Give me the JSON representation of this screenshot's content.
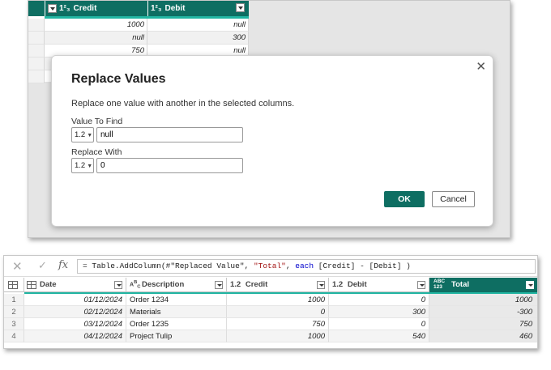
{
  "background_grid": {
    "columns": [
      {
        "type_icon": "1²₃",
        "label": "Credit"
      },
      {
        "type_icon": "1²₃",
        "label": "Debit"
      }
    ],
    "rows": [
      {
        "credit": "1000",
        "debit": "null"
      },
      {
        "credit": "null",
        "debit": "300"
      },
      {
        "credit": "750",
        "debit": "null"
      },
      {
        "credit": "",
        "debit": ""
      },
      {
        "credit": "",
        "debit": ""
      }
    ]
  },
  "dialog": {
    "title": "Replace Values",
    "description": "Replace one value with another in the selected columns.",
    "value_to_find_label": "Value To Find",
    "value_to_find_type": "1.2",
    "value_to_find": "null",
    "replace_with_label": "Replace With",
    "replace_with_type": "1.2",
    "replace_with": "0",
    "ok_label": "OK",
    "cancel_label": "Cancel",
    "close_glyph": "✕"
  },
  "formula_bar": {
    "cancel_glyph": "✕",
    "commit_glyph": "✓",
    "fx_label": "fx",
    "formula_prefix": "= Table.AddColumn(#\"Replaced Value\", ",
    "formula_string": "\"Total\"",
    "formula_mid": ", ",
    "formula_keyword": "each",
    "formula_suffix": " [Credit] - [Debit] )"
  },
  "table": {
    "columns": {
      "date": "Date",
      "description": "Description",
      "credit_type": "1.2",
      "credit": "Credit",
      "debit_type": "1.2",
      "debit": "Debit",
      "total_type_top": "ABC",
      "total_type_bottom": "123",
      "total": "Total",
      "description_type_top": "A",
      "description_type_bottom": "B",
      "description_type_sub": "C"
    },
    "rows": [
      {
        "num": "1",
        "date": "01/12/2024",
        "description": "Order 1234",
        "credit": "1000",
        "debit": "0",
        "total": "1000"
      },
      {
        "num": "2",
        "date": "02/12/2024",
        "description": "Materials",
        "credit": "0",
        "debit": "300",
        "total": "-300"
      },
      {
        "num": "3",
        "date": "03/12/2024",
        "description": "Order 1235",
        "credit": "750",
        "debit": "0",
        "total": "750"
      },
      {
        "num": "4",
        "date": "04/12/2024",
        "description": "Project Tulip",
        "credit": "1000",
        "debit": "540",
        "total": "460"
      }
    ]
  },
  "colors": {
    "accent": "#0e6e62",
    "accent_light": "#21b5a2"
  }
}
